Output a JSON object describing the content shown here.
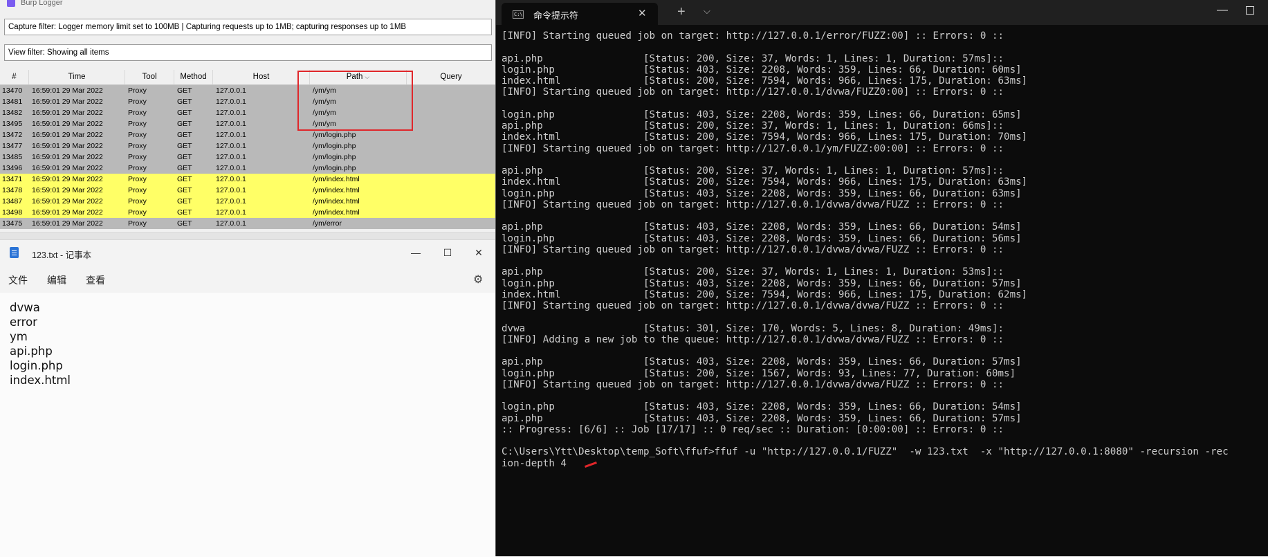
{
  "burp": {
    "title": "Burp Logger",
    "capture_filter": "Capture filter: Logger memory limit set to 100MB | Capturing requests up to 1MB;  capturing responses up to 1MB",
    "view_filter": "View filter: Showing all items",
    "columns": [
      "#",
      "Time",
      "Tool",
      "Method",
      "Host",
      "Path",
      "Query"
    ],
    "sort_icon": "chevron-down-icon",
    "rows": [
      [
        "13470",
        "16:59:01 29 Mar 2022",
        "Proxy",
        "GET",
        "127.0.0.1",
        "/ym/ym"
      ],
      [
        "13481",
        "16:59:01 29 Mar 2022",
        "Proxy",
        "GET",
        "127.0.0.1",
        "/ym/ym"
      ],
      [
        "13482",
        "16:59:01 29 Mar 2022",
        "Proxy",
        "GET",
        "127.0.0.1",
        "/ym/ym"
      ],
      [
        "13495",
        "16:59:01 29 Mar 2022",
        "Proxy",
        "GET",
        "127.0.0.1",
        "/ym/ym"
      ],
      [
        "13472",
        "16:59:01 29 Mar 2022",
        "Proxy",
        "GET",
        "127.0.0.1",
        "/ym/login.php"
      ],
      [
        "13477",
        "16:59:01 29 Mar 2022",
        "Proxy",
        "GET",
        "127.0.0.1",
        "/ym/login.php"
      ],
      [
        "13485",
        "16:59:01 29 Mar 2022",
        "Proxy",
        "GET",
        "127.0.0.1",
        "/ym/login.php"
      ],
      [
        "13496",
        "16:59:01 29 Mar 2022",
        "Proxy",
        "GET",
        "127.0.0.1",
        "/ym/login.php"
      ],
      [
        "13471",
        "16:59:01 29 Mar 2022",
        "Proxy",
        "GET",
        "127.0.0.1",
        "/ym/index.html"
      ],
      [
        "13478",
        "16:59:01 29 Mar 2022",
        "Proxy",
        "GET",
        "127.0.0.1",
        "/ym/index.html"
      ],
      [
        "13487",
        "16:59:01 29 Mar 2022",
        "Proxy",
        "GET",
        "127.0.0.1",
        "/ym/index.html"
      ],
      [
        "13498",
        "16:59:01 29 Mar 2022",
        "Proxy",
        "GET",
        "127.0.0.1",
        "/ym/index.html"
      ],
      [
        "13475",
        "16:59:01 29 Mar 2022",
        "Proxy",
        "GET",
        "127.0.0.1",
        "/ym/error"
      ]
    ],
    "highlighted_rows": [
      8,
      9,
      10,
      11
    ],
    "colors": {
      "row_gray": "#b9b9b9",
      "row_highlight": "#ffff66",
      "annotation": "#e0262a"
    }
  },
  "notepad": {
    "title": "123.txt - 记事本",
    "menu": [
      "文件",
      "编辑",
      "查看"
    ],
    "lines": [
      "dvwa",
      "error",
      "ym",
      "api.php",
      "login.php",
      "index.html"
    ]
  },
  "terminal": {
    "tab_title": "命令提示符",
    "lines": [
      "[INFO] Starting queued job on target: http://127.0.0.1/error/FUZZ:00] :: Errors: 0 ::",
      "",
      "api.php                 [Status: 200, Size: 37, Words: 1, Lines: 1, Duration: 57ms]::",
      "login.php               [Status: 403, Size: 2208, Words: 359, Lines: 66, Duration: 60ms]",
      "index.html              [Status: 200, Size: 7594, Words: 966, Lines: 175, Duration: 63ms]",
      "[INFO] Starting queued job on target: http://127.0.0.1/dvwa/FUZZ0:00] :: Errors: 0 ::",
      "",
      "login.php               [Status: 403, Size: 2208, Words: 359, Lines: 66, Duration: 65ms]",
      "api.php                 [Status: 200, Size: 37, Words: 1, Lines: 1, Duration: 66ms]::",
      "index.html              [Status: 200, Size: 7594, Words: 966, Lines: 175, Duration: 70ms]",
      "[INFO] Starting queued job on target: http://127.0.0.1/ym/FUZZ:00:00] :: Errors: 0 ::",
      "",
      "api.php                 [Status: 200, Size: 37, Words: 1, Lines: 1, Duration: 57ms]::",
      "index.html              [Status: 200, Size: 7594, Words: 966, Lines: 175, Duration: 63ms]",
      "login.php               [Status: 403, Size: 2208, Words: 359, Lines: 66, Duration: 63ms]",
      "[INFO] Starting queued job on target: http://127.0.0.1/dvwa/dvwa/FUZZ :: Errors: 0 ::",
      "",
      "api.php                 [Status: 403, Size: 2208, Words: 359, Lines: 66, Duration: 54ms]",
      "login.php               [Status: 403, Size: 2208, Words: 359, Lines: 66, Duration: 56ms]",
      "[INFO] Starting queued job on target: http://127.0.0.1/dvwa/dvwa/FUZZ :: Errors: 0 ::",
      "",
      "api.php                 [Status: 200, Size: 37, Words: 1, Lines: 1, Duration: 53ms]::",
      "login.php               [Status: 403, Size: 2208, Words: 359, Lines: 66, Duration: 57ms]",
      "index.html              [Status: 200, Size: 7594, Words: 966, Lines: 175, Duration: 62ms]",
      "[INFO] Starting queued job on target: http://127.0.0.1/dvwa/dvwa/FUZZ :: Errors: 0 ::",
      "",
      "dvwa                    [Status: 301, Size: 170, Words: 5, Lines: 8, Duration: 49ms]:",
      "[INFO] Adding a new job to the queue: http://127.0.0.1/dvwa/dvwa/FUZZ :: Errors: 0 ::",
      "",
      "api.php                 [Status: 403, Size: 2208, Words: 359, Lines: 66, Duration: 57ms]",
      "login.php               [Status: 200, Size: 1567, Words: 93, Lines: 77, Duration: 60ms]",
      "[INFO] Starting queued job on target: http://127.0.0.1/dvwa/dvwa/FUZZ :: Errors: 0 ::",
      "",
      "login.php               [Status: 403, Size: 2208, Words: 359, Lines: 66, Duration: 54ms]",
      "api.php                 [Status: 403, Size: 2208, Words: 359, Lines: 66, Duration: 57ms]",
      ":: Progress: [6/6] :: Job [17/17] :: 0 req/sec :: Duration: [0:00:00] :: Errors: 0 ::",
      "",
      "C:\\Users\\Ytt\\Desktop\\temp_Soft\\ffuf>ffuf -u \"http://127.0.0.1/FUZZ\"  -w 123.txt  -x \"http://127.0.0.1:8080\" -recursion -rec",
      "ion-depth 4 "
    ]
  }
}
